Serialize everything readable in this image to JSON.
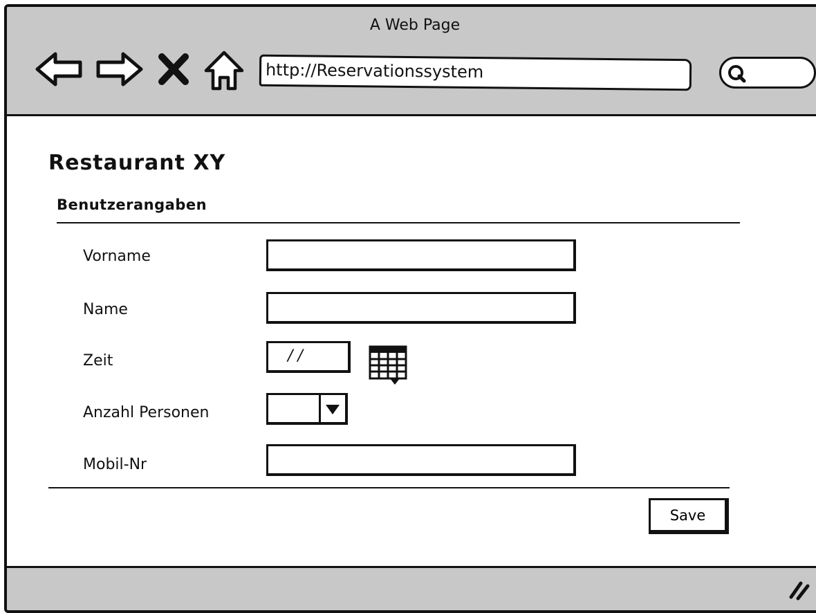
{
  "window": {
    "title": "A Web Page"
  },
  "browser": {
    "url": "http://Reservationssystem",
    "search_placeholder": ""
  },
  "page": {
    "title": "Restaurant XY",
    "section_title": "Benutzerangaben"
  },
  "form": {
    "fields": {
      "vorname": {
        "label": "Vorname",
        "value": ""
      },
      "name": {
        "label": "Name",
        "value": ""
      },
      "zeit": {
        "label": "Zeit",
        "value": "/ /"
      },
      "anzahl": {
        "label": "Anzahl Personen",
        "value": ""
      },
      "mobil": {
        "label": "Mobil-Nr",
        "value": ""
      }
    },
    "save_label": "Save"
  },
  "icons": {
    "back": "back-arrow-icon",
    "forward": "forward-arrow-icon",
    "stop": "close-icon",
    "home": "home-icon",
    "search": "search-icon",
    "calendar": "calendar-icon",
    "dropdown": "chevron-down-icon",
    "resize": "resize-handle-icon"
  },
  "colors": {
    "chrome": "#c8c8c8",
    "ink": "#111111",
    "background": "#ffffff"
  }
}
